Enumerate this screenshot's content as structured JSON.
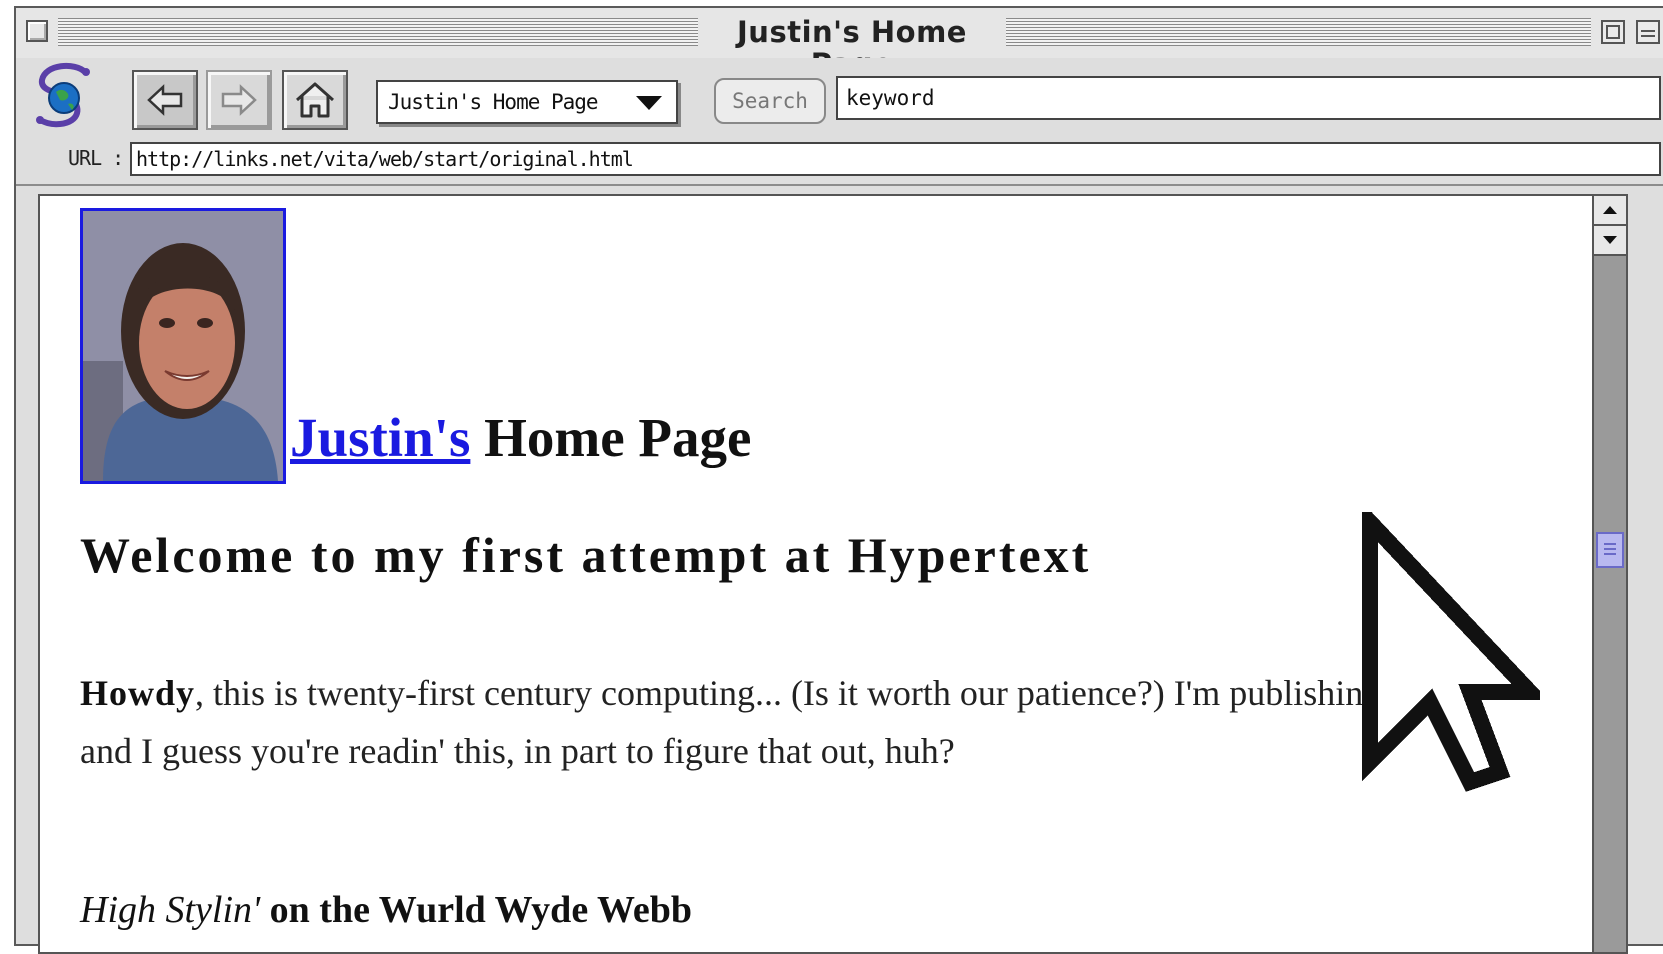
{
  "window": {
    "title": "Justin's Home Page"
  },
  "toolbar": {
    "location_value": "Justin's Home Page",
    "search_label": "Search",
    "search_value": "keyword"
  },
  "url_bar": {
    "label": "URL :",
    "value": "http://links.net/vita/web/start/original.html"
  },
  "page": {
    "heading_link": "Justin's",
    "heading_rest": " Home Page",
    "welcome": "Welcome to my first attempt at Hypertext",
    "intro_bold": "Howdy",
    "intro_text": ", this is twenty-first century computing... (Is it worth our patience?) I'm publishing this, and I guess you're readin' this, in part to figure that out, huh?",
    "subhead_italic": "High Stylin'",
    "subhead_rest": "  on the Wurld Wyde Webb"
  },
  "colors": {
    "link": "#1a1ae0",
    "chrome": "#dedede"
  }
}
